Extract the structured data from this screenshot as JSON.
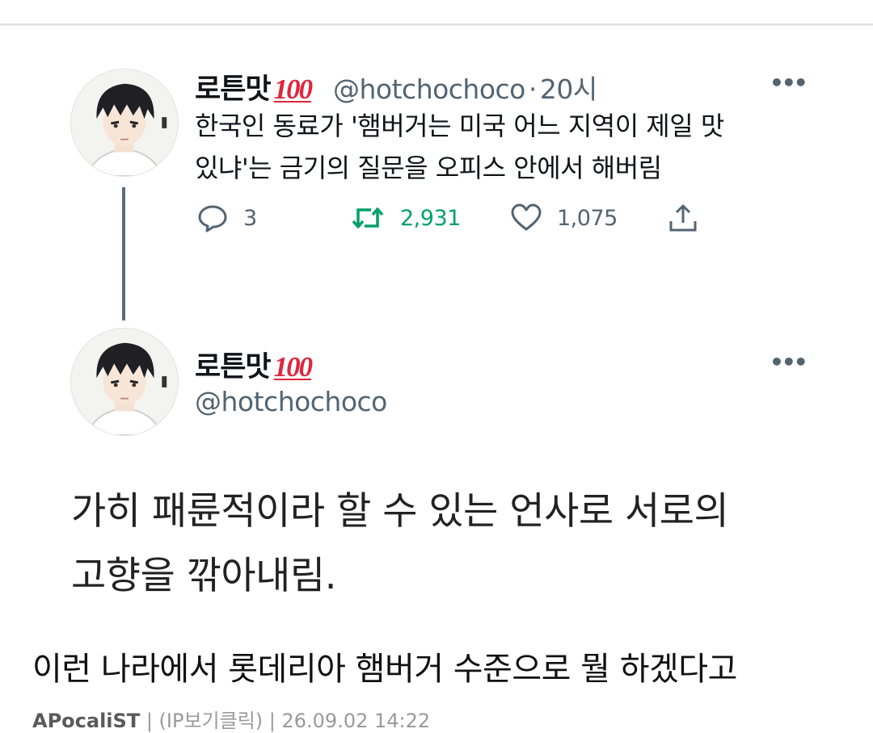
{
  "tweet": {
    "author_name": "로튼맛",
    "author_badge": "100",
    "handle": "@hotchochoco",
    "separator": "·",
    "time": "20시",
    "text_line1": "한국인 동료가 '햄버거는 미국 어느 지역이 제일 맛",
    "text_line2": "있냐'는 금기의 질문을 오피스 안에서 해버림",
    "actions": {
      "reply_count": "3",
      "retweet_count": "2,931",
      "like_count": "1,075"
    },
    "more": "•••"
  },
  "reply": {
    "author_name": "로튼맛",
    "author_badge": "100",
    "handle": "@hotchochoco",
    "more": "•••",
    "text_line1": "가히 패륜적이라 할 수 있는 언사로 서로의",
    "text_line2": "고향을 깎아내림."
  },
  "post": {
    "caption": "이런 나라에서 롯데리아 햄버거 수준으로 뭘 하겠다고",
    "author": "APocaliST",
    "meta_rest": "| (IP보기클릭) | 26.09.02 14:22"
  },
  "colors": {
    "retweet_green": "#00a06a",
    "badge_red": "#e0263d",
    "secondary_text": "#536471"
  },
  "icons": [
    "more-icon",
    "reply-icon",
    "retweet-icon",
    "like-icon",
    "share-icon"
  ]
}
